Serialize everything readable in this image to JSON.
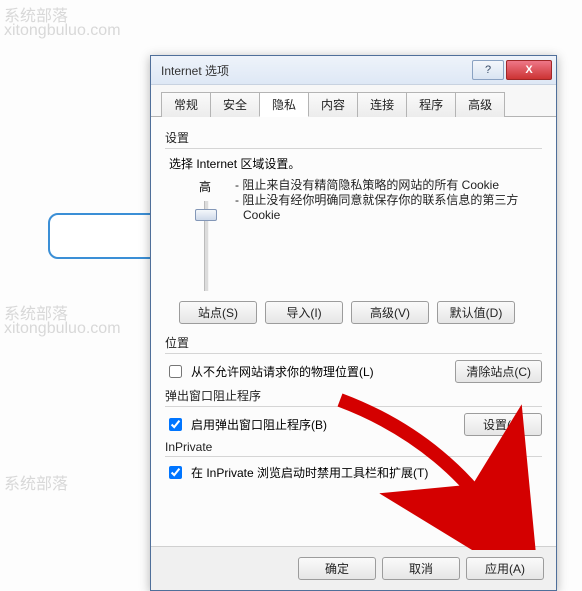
{
  "watermarks": [
    "系统部落",
    "xitongbuluo.com"
  ],
  "window": {
    "title": "Internet 选项",
    "win_buttons": {
      "help": "?",
      "close": "X"
    }
  },
  "tabs": {
    "items": [
      "常规",
      "安全",
      "隐私",
      "内容",
      "连接",
      "程序",
      "高级"
    ],
    "active_index": 2
  },
  "settings": {
    "group": "设置",
    "desc": "选择 Internet 区域设置。",
    "level": "高",
    "bullet1": "- 阻止来自没有精简隐私策略的网站的所有 Cookie",
    "bullet2": "- 阻止没有经你明确同意就保存你的联系信息的第三方 Cookie",
    "buttons": {
      "sites": "站点(S)",
      "import": "导入(I)",
      "advanced": "高级(V)",
      "default": "默认值(D)"
    }
  },
  "location": {
    "group": "位置",
    "checkbox": "从不允许网站请求你的物理位置(L)",
    "clear": "清除站点(C)"
  },
  "popup": {
    "group": "弹出窗口阻止程序",
    "checkbox": "启用弹出窗口阻止程序(B)",
    "settings": "设置(E)"
  },
  "inprivate": {
    "group": "InPrivate",
    "checkbox": "在 InPrivate 浏览启动时禁用工具栏和扩展(T)"
  },
  "footer": {
    "ok": "确定",
    "cancel": "取消",
    "apply": "应用(A)"
  }
}
